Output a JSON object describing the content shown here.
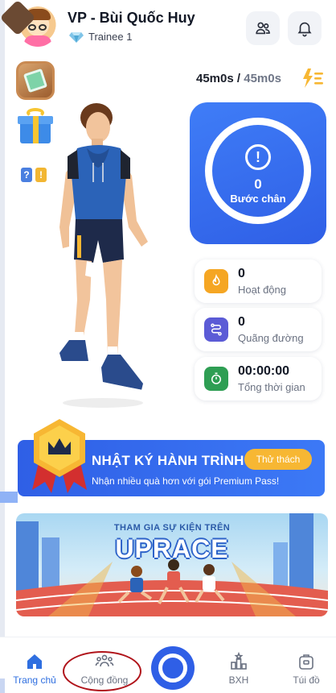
{
  "header": {
    "user_name": "VP - Bùi Quốc Huy",
    "rank_label": "Trainee 1",
    "community_icon": "people-icon",
    "notification_icon": "bell-icon"
  },
  "side_badges": [
    "map-badge-icon",
    "gift-icon",
    "quiz-badge-icon"
  ],
  "quiz_badge_text": [
    "?",
    "!"
  ],
  "timer": {
    "current": "45m0s",
    "separator": " / ",
    "target": "45m0s",
    "icon": "lightning-list-icon"
  },
  "steps": {
    "value": "0",
    "label": "Bước chân",
    "alert_symbol": "!"
  },
  "stats": [
    {
      "value": "0",
      "label": "Hoạt động",
      "icon": "fire-icon",
      "color": "#f5a623"
    },
    {
      "value": "0",
      "label": "Quãng đường",
      "icon": "route-icon",
      "color": "#5b5bd6"
    },
    {
      "value": "00:00:00",
      "label": "Tổng thời gian",
      "icon": "stopwatch-icon",
      "color": "#2e9e53"
    }
  ],
  "journey": {
    "title": "NHẬT KÝ HÀNH TRÌNH",
    "subtitle": "Nhận nhiều quà hơn với gói Premium Pass!",
    "button": "Thử thách",
    "icon": "crown-icon"
  },
  "event_banner": {
    "title": "THAM GIA SỰ KIỆN TRÊN",
    "brand": "UPRACE"
  },
  "bottom_nav": {
    "items": [
      {
        "label": "Trang chủ",
        "icon": "home-icon",
        "active": true
      },
      {
        "label": "Cộng đồng",
        "icon": "community-icon",
        "active": false
      },
      {
        "label": "BXH",
        "icon": "leaderboard-icon",
        "active": false
      },
      {
        "label": "Túi đồ",
        "icon": "bag-icon",
        "active": false
      }
    ],
    "center_icon": "record-button-icon"
  },
  "colors": {
    "primary_blue": "#2f5fe6",
    "accent_orange": "#f7b733",
    "highlight_red": "#b0131a"
  }
}
